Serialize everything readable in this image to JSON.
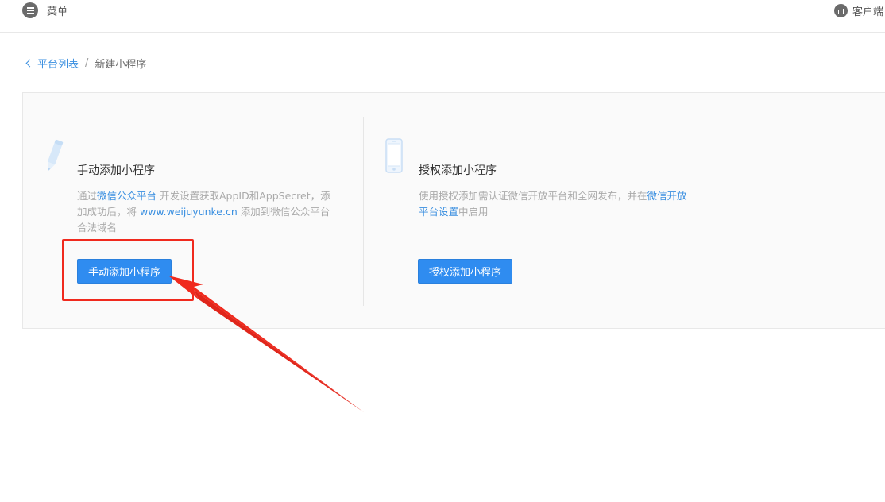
{
  "topbar": {
    "menu_label": "菜单",
    "client_label": "客户端"
  },
  "breadcrumb": {
    "parent": "平台列表",
    "separator": "/",
    "current": "新建小程序"
  },
  "manual": {
    "title": "手动添加小程序",
    "desc_part1": "通过",
    "desc_link1": "微信公众平台",
    "desc_part2": " 开发设置获取AppID和AppSecret，添加成功后，将 ",
    "desc_link2": "www.weijuyunke.cn",
    "desc_part3": " 添加到微信公众平台合法域名",
    "button_label": "手动添加小程序"
  },
  "authorize": {
    "title": "授权添加小程序",
    "desc_part1": "使用授权添加需认证微信开放平台和全网发布，并在",
    "desc_link1": "微信开放平台设置",
    "desc_part2": "中启用",
    "button_label": "授权添加小程序"
  },
  "colors": {
    "accent": "#2f8cf0",
    "link": "#3a8fe0",
    "annotation": "#f02a1e"
  },
  "icons": {
    "menu": "menu-list-icon",
    "client": "client-icon",
    "back": "chevron-left-icon",
    "manual": "pencil-icon",
    "authorize": "phone-icon"
  }
}
